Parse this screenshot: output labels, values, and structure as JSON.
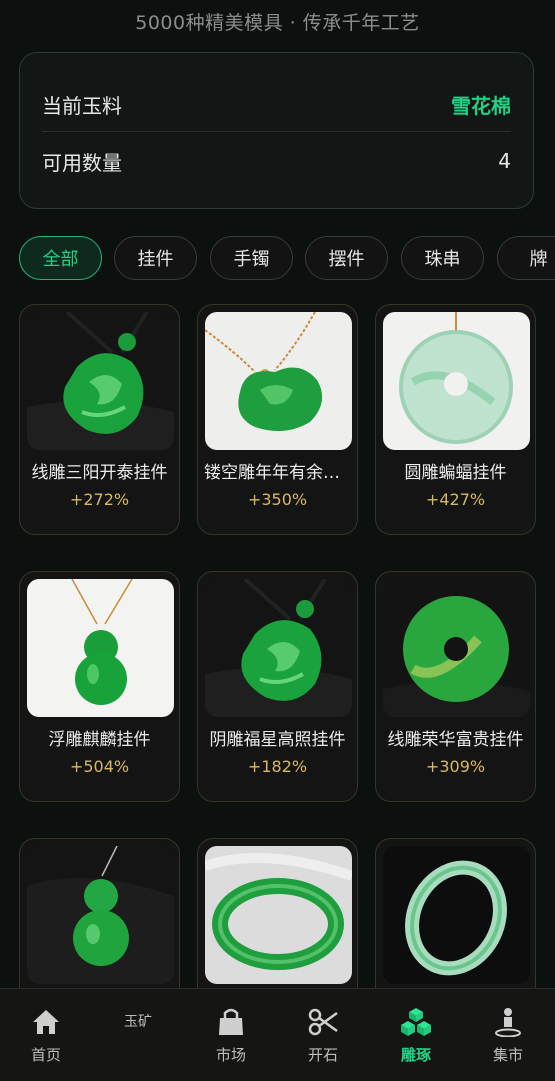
{
  "header": {
    "subtitle": "5000种精美模具 · 传承千年工艺"
  },
  "info": {
    "material_label": "当前玉料",
    "material_value": "雪花棉",
    "quantity_label": "可用数量",
    "quantity_value": "4",
    "accent_color": "#21d185"
  },
  "tabs": [
    {
      "label": "全部",
      "active": true
    },
    {
      "label": "挂件"
    },
    {
      "label": "手镯"
    },
    {
      "label": "摆件"
    },
    {
      "label": "珠串"
    },
    {
      "label": "牌"
    }
  ],
  "products": [
    {
      "name": "线雕三阳开泰挂件",
      "percent": "+272%",
      "icon": "jade-carved-pendant"
    },
    {
      "name": "镂空雕年年有余挂件",
      "percent": "+350%",
      "icon": "jade-cloud-pendant"
    },
    {
      "name": "圆雕蝙蝠挂件",
      "percent": "+427%",
      "icon": "jade-disc-pendant"
    },
    {
      "name": "浮雕麒麟挂件",
      "percent": "+504%",
      "icon": "jade-gourd-pendant"
    },
    {
      "name": "阴雕福星高照挂件",
      "percent": "+182%",
      "icon": "jade-carved-pendant"
    },
    {
      "name": "线雕荣华富贵挂件",
      "percent": "+309%",
      "icon": "jade-donut-disc"
    },
    {
      "name": "",
      "percent": "",
      "icon": "jade-gourd-pendant"
    },
    {
      "name": "",
      "percent": "",
      "icon": "jade-bangle"
    },
    {
      "name": "",
      "percent": "",
      "icon": "jade-bangle-icy"
    }
  ],
  "nav": [
    {
      "label": "首页",
      "icon": "home-icon"
    },
    {
      "label": "玉矿",
      "icon": ""
    },
    {
      "label": "市场",
      "icon": "shopping-bag-icon"
    },
    {
      "label": "开石",
      "icon": "scissors-icon"
    },
    {
      "label": "雕琢",
      "icon": "cubes-icon",
      "active": true
    },
    {
      "label": "集市",
      "icon": "person-pin-icon"
    }
  ]
}
